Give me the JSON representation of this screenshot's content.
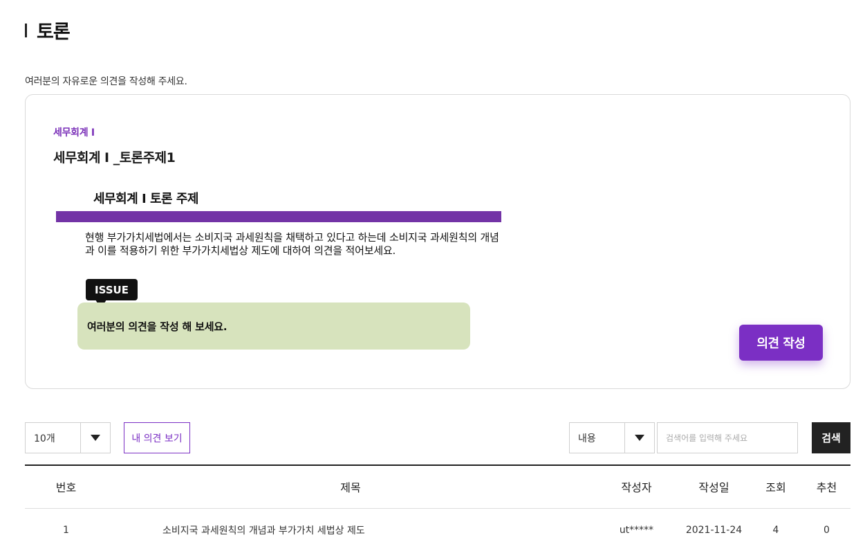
{
  "page": {
    "title": "토론",
    "intro": "여러분의 자유로운 의견을 작성해 주세요."
  },
  "topic_card": {
    "category": "세무회계 I",
    "title": "세무회계 I _토론주제1",
    "document": {
      "heading": "세무회계 I  토론 주제",
      "body": "현행 부가가치세법에서는 소비지국 과세원칙을 채택하고 있다고 하는데 소비지국 과세원칙의 개념과 이를 적용하기 위한 부가가치세법상 제도에 대하여 의견을 적어보세요.",
      "issue_label": "ISSUE",
      "issue_text": "여러분의 의견을 작성 해 보세요."
    },
    "write_button": "의견 작성"
  },
  "toolbar": {
    "page_size": {
      "selected": "10개"
    },
    "my_opinion_button": "내 의견 보기",
    "search_type": {
      "selected": "내용"
    },
    "search_placeholder": "검색어를 입력해 주세요",
    "search_button": "검색"
  },
  "table": {
    "headers": [
      "번호",
      "제목",
      "작성자",
      "작성일",
      "조회",
      "추천"
    ],
    "rows": [
      {
        "no": "1",
        "title": "소비지국 과세원칙의 개념과 부가가치 세법상 제도",
        "author": "ut*****",
        "date": "2021-11-24",
        "views": "4",
        "likes": "0"
      }
    ]
  },
  "colors": {
    "accent": "#7b2fc4",
    "doc_rule": "#7333a6",
    "issue_bg": "#d7e3bd",
    "dark": "#222222"
  },
  "icons": {
    "dropdown": "caret-down-icon"
  }
}
